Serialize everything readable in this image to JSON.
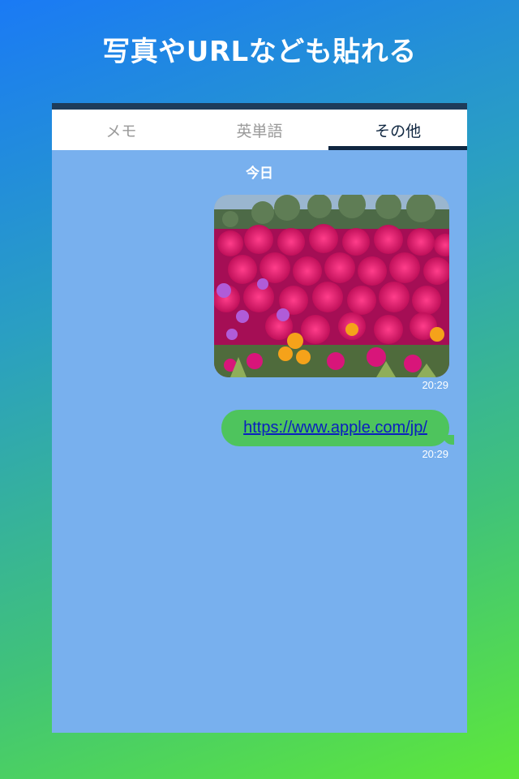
{
  "headline": "写真やURLなども貼れる",
  "tabs": [
    {
      "label": "メモ",
      "active": false
    },
    {
      "label": "英単語",
      "active": false
    },
    {
      "label": "その他",
      "active": true
    }
  ],
  "chat": {
    "date_label": "今日",
    "messages": [
      {
        "type": "image",
        "image_description": "flower field photo",
        "time": "20:29"
      },
      {
        "type": "link",
        "text": "https://www.apple.com/jp/",
        "time": "20:29"
      }
    ]
  },
  "colors": {
    "chat_background": "#78b0ee",
    "tab_active": "#0f2640",
    "bubble_green": "#4ec45d",
    "link": "#0a1fbf"
  }
}
